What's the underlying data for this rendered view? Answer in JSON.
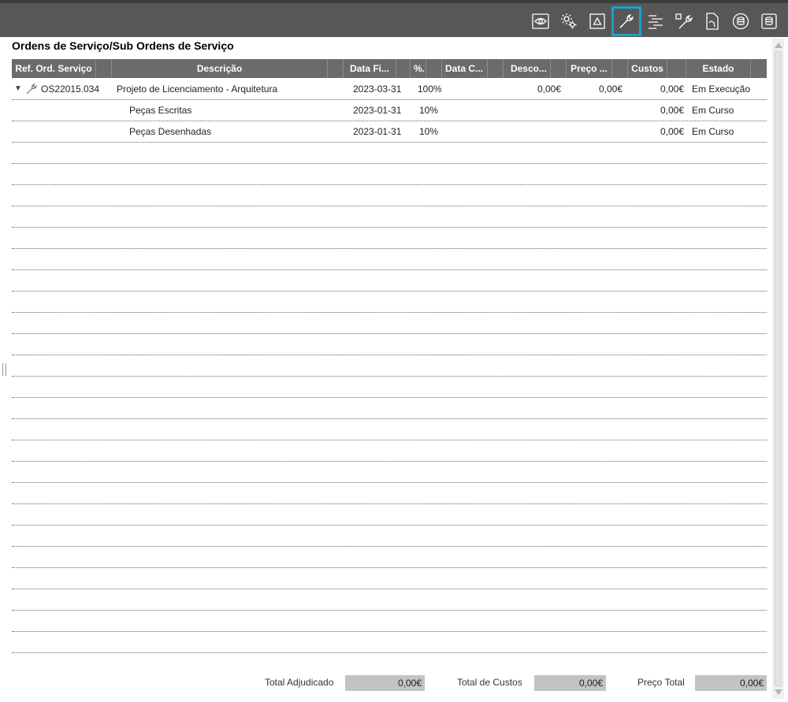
{
  "toolbar": {
    "icons": [
      {
        "name": "eye-icon"
      },
      {
        "name": "gears-icon"
      },
      {
        "name": "triangle-icon"
      },
      {
        "name": "wrench-icon",
        "active": true
      },
      {
        "name": "gantt-icon"
      },
      {
        "name": "wrench-square-icon"
      },
      {
        "name": "document-icon"
      },
      {
        "name": "database-circle-icon"
      },
      {
        "name": "database-box-icon"
      }
    ],
    "accent_color": "#1ba1c4"
  },
  "panel": {
    "title": "Ordens de Serviço/Sub Ordens de Serviço"
  },
  "grid": {
    "columns": [
      "Ref. Ord. Serviço",
      "Descrição",
      "Data Fi...",
      "%.",
      "Data C...",
      "Desco...",
      "Preço ...",
      "Custos",
      "Estado"
    ],
    "rows": [
      {
        "ref": "OS22015.034",
        "descricao": "Projeto de Licenciamento - Arquitetura",
        "data_fim": "2023-03-31",
        "pct": "100%",
        "data_c": "",
        "desconto": "0,00€",
        "preco": "0,00€",
        "custos": "0,00€",
        "estado": "Em Execução"
      },
      {
        "ref": "",
        "descricao": "Peças Escritas",
        "data_fim": "2023-01-31",
        "pct": "10%",
        "data_c": "",
        "desconto": "",
        "preco": "",
        "custos": "0,00€",
        "estado": "Em Curso"
      },
      {
        "ref": "",
        "descricao": "Peças Desenhadas",
        "data_fim": "2023-01-31",
        "pct": "10%",
        "data_c": "",
        "desconto": "",
        "preco": "",
        "custos": "0,00€",
        "estado": "Em Curso"
      }
    ]
  },
  "totals": {
    "adjudicado_label": "Total Adjudicado",
    "adjudicado_value": "0,00€",
    "custos_label": "Total de Custos",
    "custos_value": "0,00€",
    "preco_label": "Preço Total",
    "preco_value": "0,00€"
  }
}
